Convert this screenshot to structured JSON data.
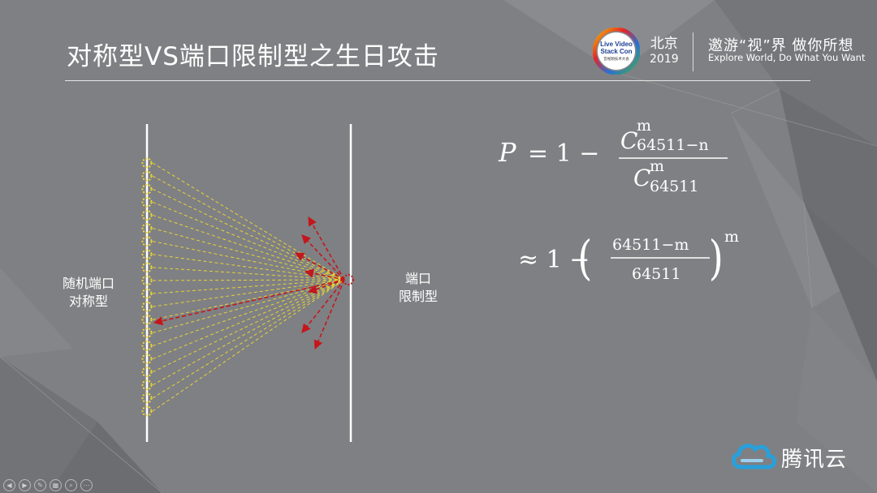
{
  "slide": {
    "title": "对称型VS端口限制型之生日攻击",
    "logo_event_line1": "Live Video",
    "logo_event_line2": "Stack Con",
    "logo_event_line3": "音视频技术大会",
    "city": "北京",
    "year": "2019",
    "slogan_cn": "邀游“视”界 做你所想",
    "slogan_en": "Explore World, Do What You Want",
    "brand_name": "腾讯云"
  },
  "diagram": {
    "left_label_line1": "随机端口",
    "left_label_line2": "对称型",
    "right_label_line1": "端口",
    "right_label_line2": "限制型",
    "left_port_count": 20,
    "probe_arrow_count": 8
  },
  "formula": {
    "p": "P",
    "eq": "= 1 −",
    "num_base": "C",
    "num_sup": "m",
    "num_sub": "64511−n",
    "den_base": "C",
    "den_sup": "m",
    "den_sub": "64511",
    "approx": "≈ 1 −",
    "frac_num": "64511−m",
    "frac_den": "64511",
    "exp": "m"
  },
  "colors": {
    "background": "#7f8083",
    "dashed_lines": "#e6d23a",
    "red_arrows": "#c4161c",
    "line_white": "#ffffff",
    "brand_blue": "#29a0da"
  },
  "controls": [
    "prev-icon",
    "next-icon",
    "pen-icon",
    "slides-icon",
    "zoom-icon",
    "more-icon"
  ]
}
